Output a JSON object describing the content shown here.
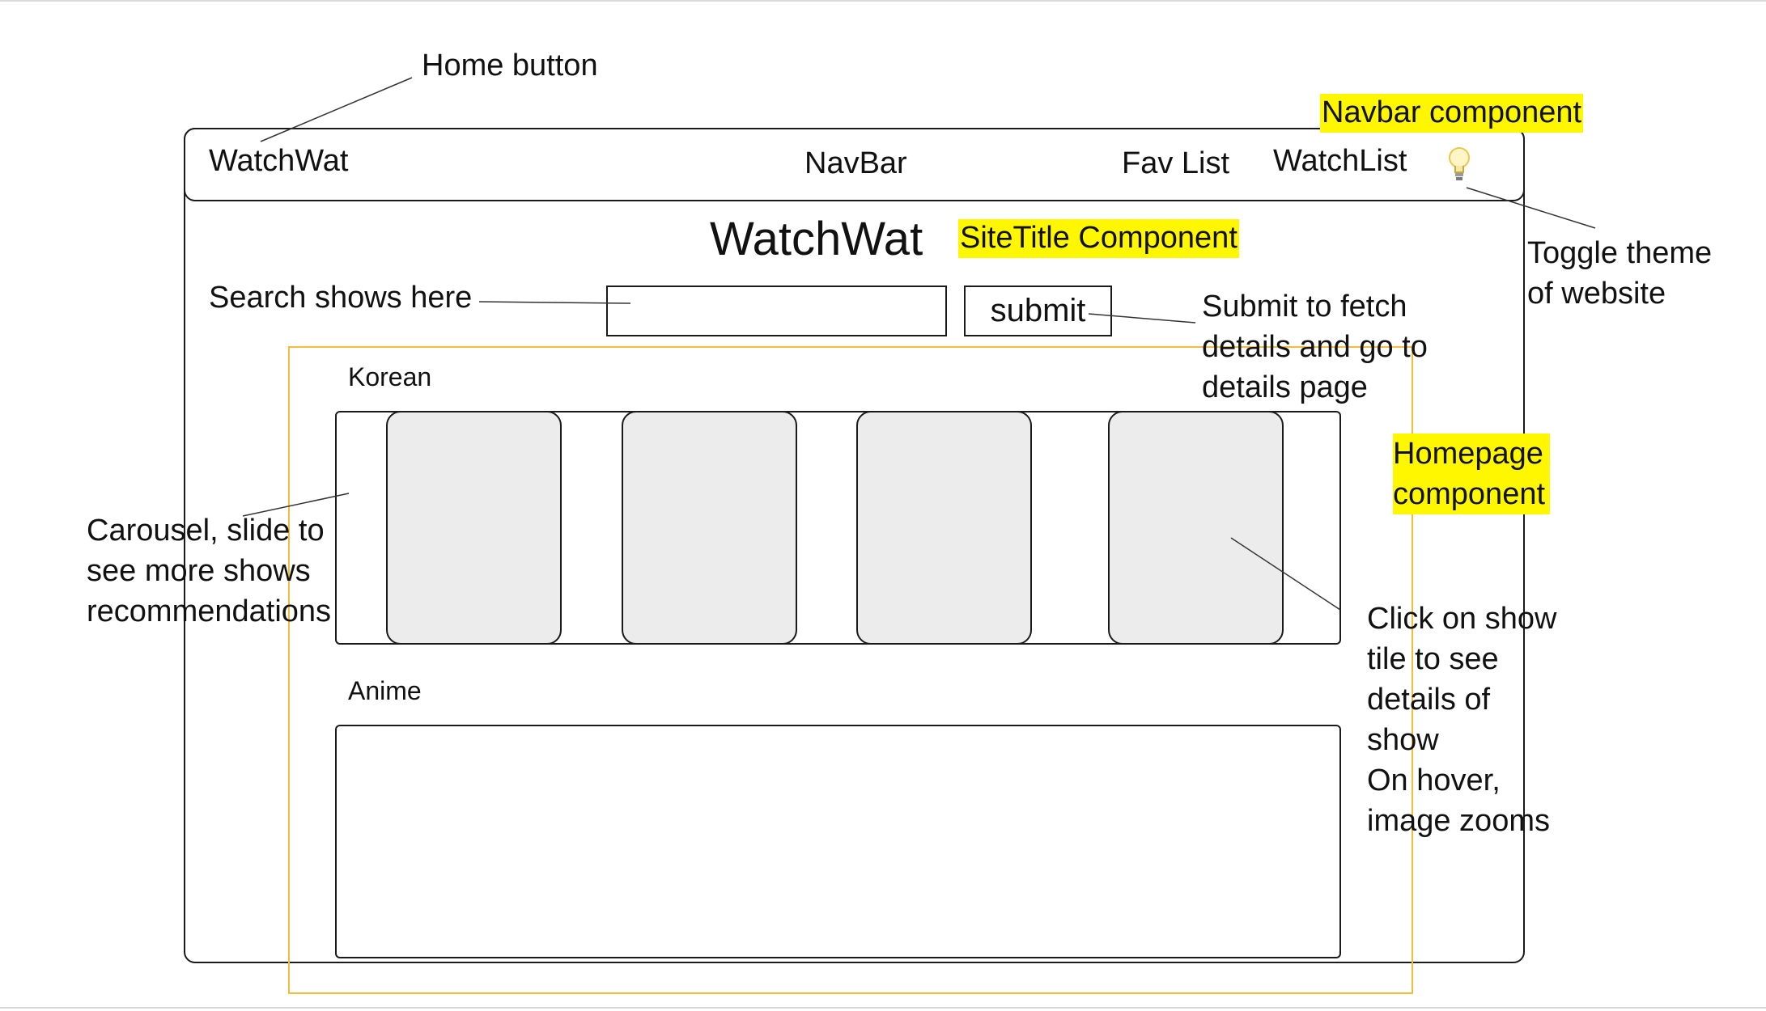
{
  "navbar": {
    "brand": "WatchWat",
    "center_label": "NavBar",
    "fav_list": "Fav List",
    "watchlist": "WatchList",
    "theme_toggle_icon": "lightbulb-icon"
  },
  "site_title": "WatchWat",
  "search": {
    "value": ""
  },
  "submit_label": "submit",
  "sections": [
    {
      "label": "Korean",
      "tiles": 4
    },
    {
      "label": "Anime"
    }
  ],
  "annotations": {
    "home_button": "Home button",
    "navbar_component": "Navbar component",
    "sitetitle_component": "SiteTitle Component",
    "toggle_theme": "Toggle theme\nof website",
    "search_shows": "Search shows here",
    "submit_desc": "Submit to fetch\ndetails and go to\ndetails page",
    "homepage_component": "Homepage\ncomponent",
    "carousel_desc": "Carousel, slide to\nsee more shows\nrecommendations",
    "tile_desc": "Click on show\ntile to see\ndetails of\nshow\nOn hover,\nimage zooms"
  },
  "colors": {
    "highlight": "#fff700",
    "homepage_border": "#f2bd3c",
    "tile_fill": "#ececec"
  }
}
